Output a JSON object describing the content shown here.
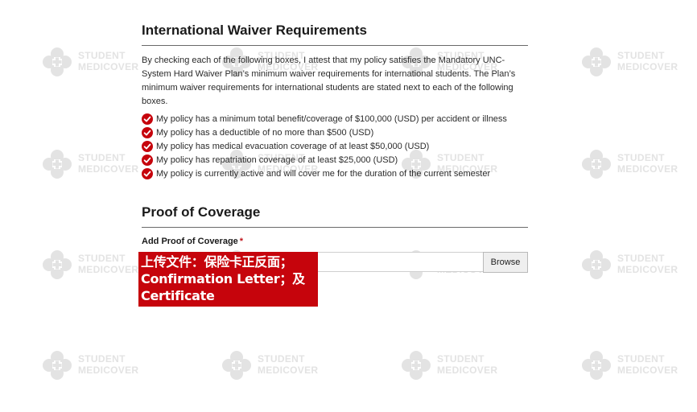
{
  "watermark": {
    "line1": "STUDENT",
    "line2": "MEDICOVER",
    "color": "#e3e3e3"
  },
  "waiver": {
    "title": "International Waiver Requirements",
    "intro": "By checking each of the following boxes, I attest that my policy satisfies the Mandatory UNC-System Hard Waiver Plan’s minimum waiver requirements for international students. The Plan’s minimum waiver requirements for international students are stated next to each of the following boxes.",
    "items": [
      "My policy has a minimum total benefit/coverage of $100,000 (USD) per accident or illness",
      "My policy has a deductible of no more than $500 (USD)",
      "My policy has medical evacuation coverage of at least $50,000 (USD)",
      "My policy has repatriation coverage of at least $25,000 (USD)",
      "My policy is currently active and will cover me for the duration of the current semester"
    ],
    "check_color": "#c6040c",
    "check_icon": "check-circle-icon"
  },
  "proof": {
    "title": "Proof of Coverage",
    "field_label": "Add Proof of Coverage",
    "required_mark": "*",
    "browse_label": "Browse"
  },
  "annotation": {
    "lines": [
      "上传文件：保险卡正反面；",
      "Confirmation Letter；及",
      "Certificate"
    ],
    "background": "#c6040c"
  }
}
